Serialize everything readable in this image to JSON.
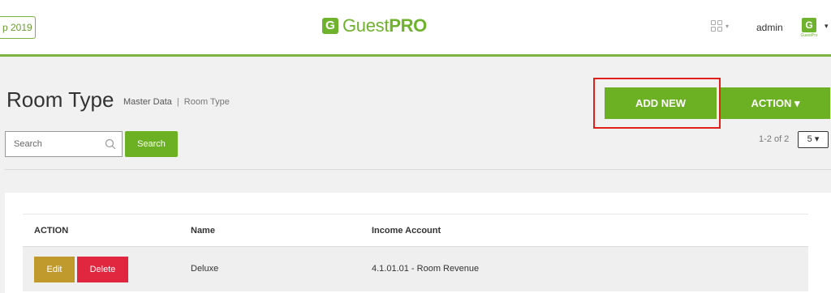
{
  "header": {
    "period_label": "p 2019",
    "logo_mark": "G",
    "logo_text_light": "Guest",
    "logo_text_bold": "PRO",
    "apps_caret": "▾",
    "user_name": "admin",
    "avatar_mark": "G",
    "avatar_text": "GuestPro",
    "user_caret": "▾",
    "accent_color": "#7cb342"
  },
  "page": {
    "title": "Room Type",
    "breadcrumb": {
      "parent": "Master Data",
      "separator": "|",
      "current": "Room Type"
    }
  },
  "toolbar": {
    "add_new_label": "ADD NEW",
    "action_label": "ACTION ▾",
    "search_placeholder": "Search",
    "search_value": "",
    "search_button_label": "Search"
  },
  "pagination": {
    "range_text": "1-2 of 2",
    "page_size": "5 ▾"
  },
  "table": {
    "columns": [
      "ACTION",
      "Name",
      "Income Account"
    ],
    "rows": [
      {
        "edit_label": "Edit",
        "delete_label": "Delete",
        "name": "Deluxe",
        "income_account": "4.1.01.01 - Room Revenue"
      }
    ]
  },
  "colors": {
    "primary_green": "#6cb024",
    "edit_gold": "#c09a2c",
    "delete_red": "#e0273f",
    "highlight_red": "#e0201a"
  }
}
